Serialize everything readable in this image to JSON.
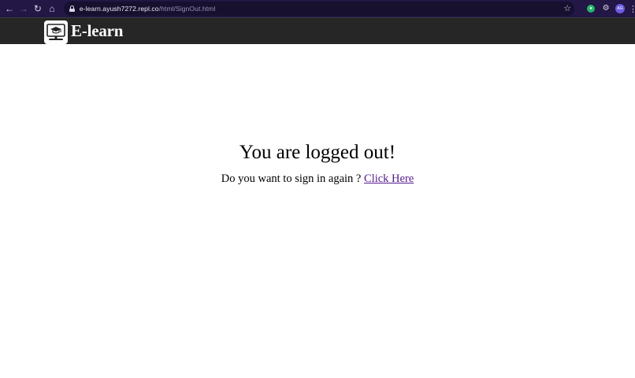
{
  "browser": {
    "url_host": "e-learn.ayush7272.repl.co",
    "url_path": "/html/SignOut.html",
    "profile_initials": "AG"
  },
  "site": {
    "brand": "E-learn"
  },
  "signout": {
    "title": "You are logged out!",
    "prompt": "Do you want to sign in again ? ",
    "link_label": "Click Here"
  },
  "colors": {
    "chrome_bg": "#221745",
    "header_bg": "#262626",
    "link_visited": "#551a8b"
  }
}
